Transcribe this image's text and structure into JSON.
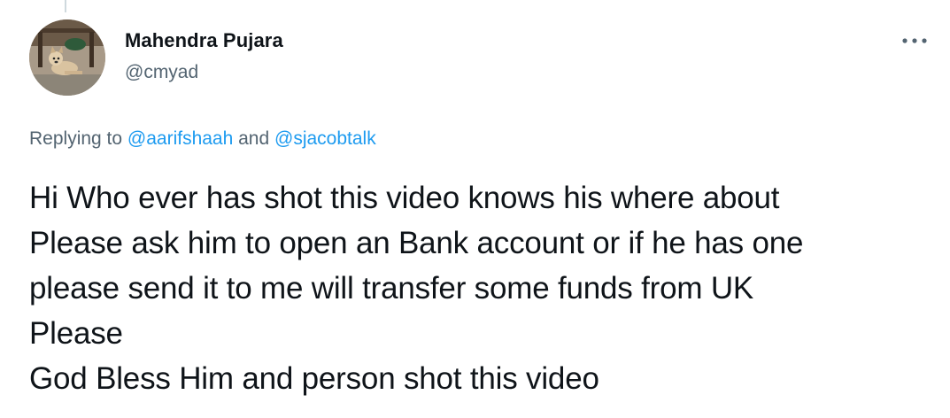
{
  "author": {
    "display_name": "Mahendra Pujara",
    "handle": "@cmyad",
    "avatar_icon": "dog-photo-avatar"
  },
  "menu": {
    "more_icon": "more-horizontal-icon"
  },
  "reply": {
    "prefix": "Replying to ",
    "mention_1": "@aarifshaah",
    "conjunction": " and ",
    "mention_2": "@sjacobtalk"
  },
  "tweet": {
    "lines": [
      "Hi Who ever has shot this video knows his where about",
      "Please ask him to open an Bank account or if he has one",
      "please send it to me will transfer some funds from UK",
      "Please",
      "God Bless Him and person shot this video"
    ]
  },
  "colors": {
    "text": "#0f1419",
    "secondary": "#536471",
    "link": "#1d9bf0"
  }
}
